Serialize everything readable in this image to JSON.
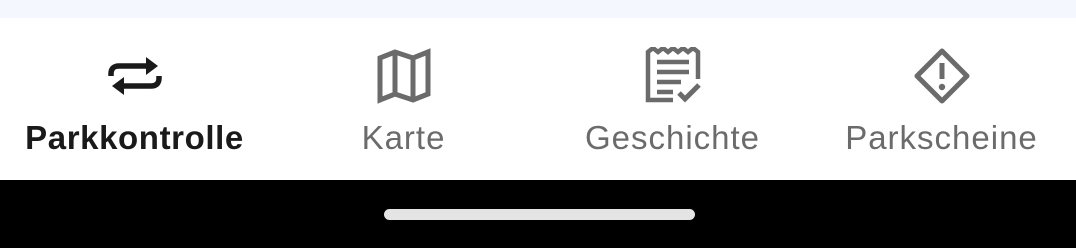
{
  "bottom_nav": {
    "items": [
      {
        "label": "Parkkontrolle",
        "icon": "repeat-icon",
        "active": true
      },
      {
        "label": "Karte",
        "icon": "map-icon",
        "active": false
      },
      {
        "label": "Geschichte",
        "icon": "receipt-check-icon",
        "active": false
      },
      {
        "label": "Parkscheine",
        "icon": "warning-diamond-icon",
        "active": false
      }
    ]
  },
  "colors": {
    "active": "#1a1a1a",
    "inactive": "#6b6b6b",
    "system_bar": "#000000",
    "home_indicator": "#e4e4e4"
  }
}
